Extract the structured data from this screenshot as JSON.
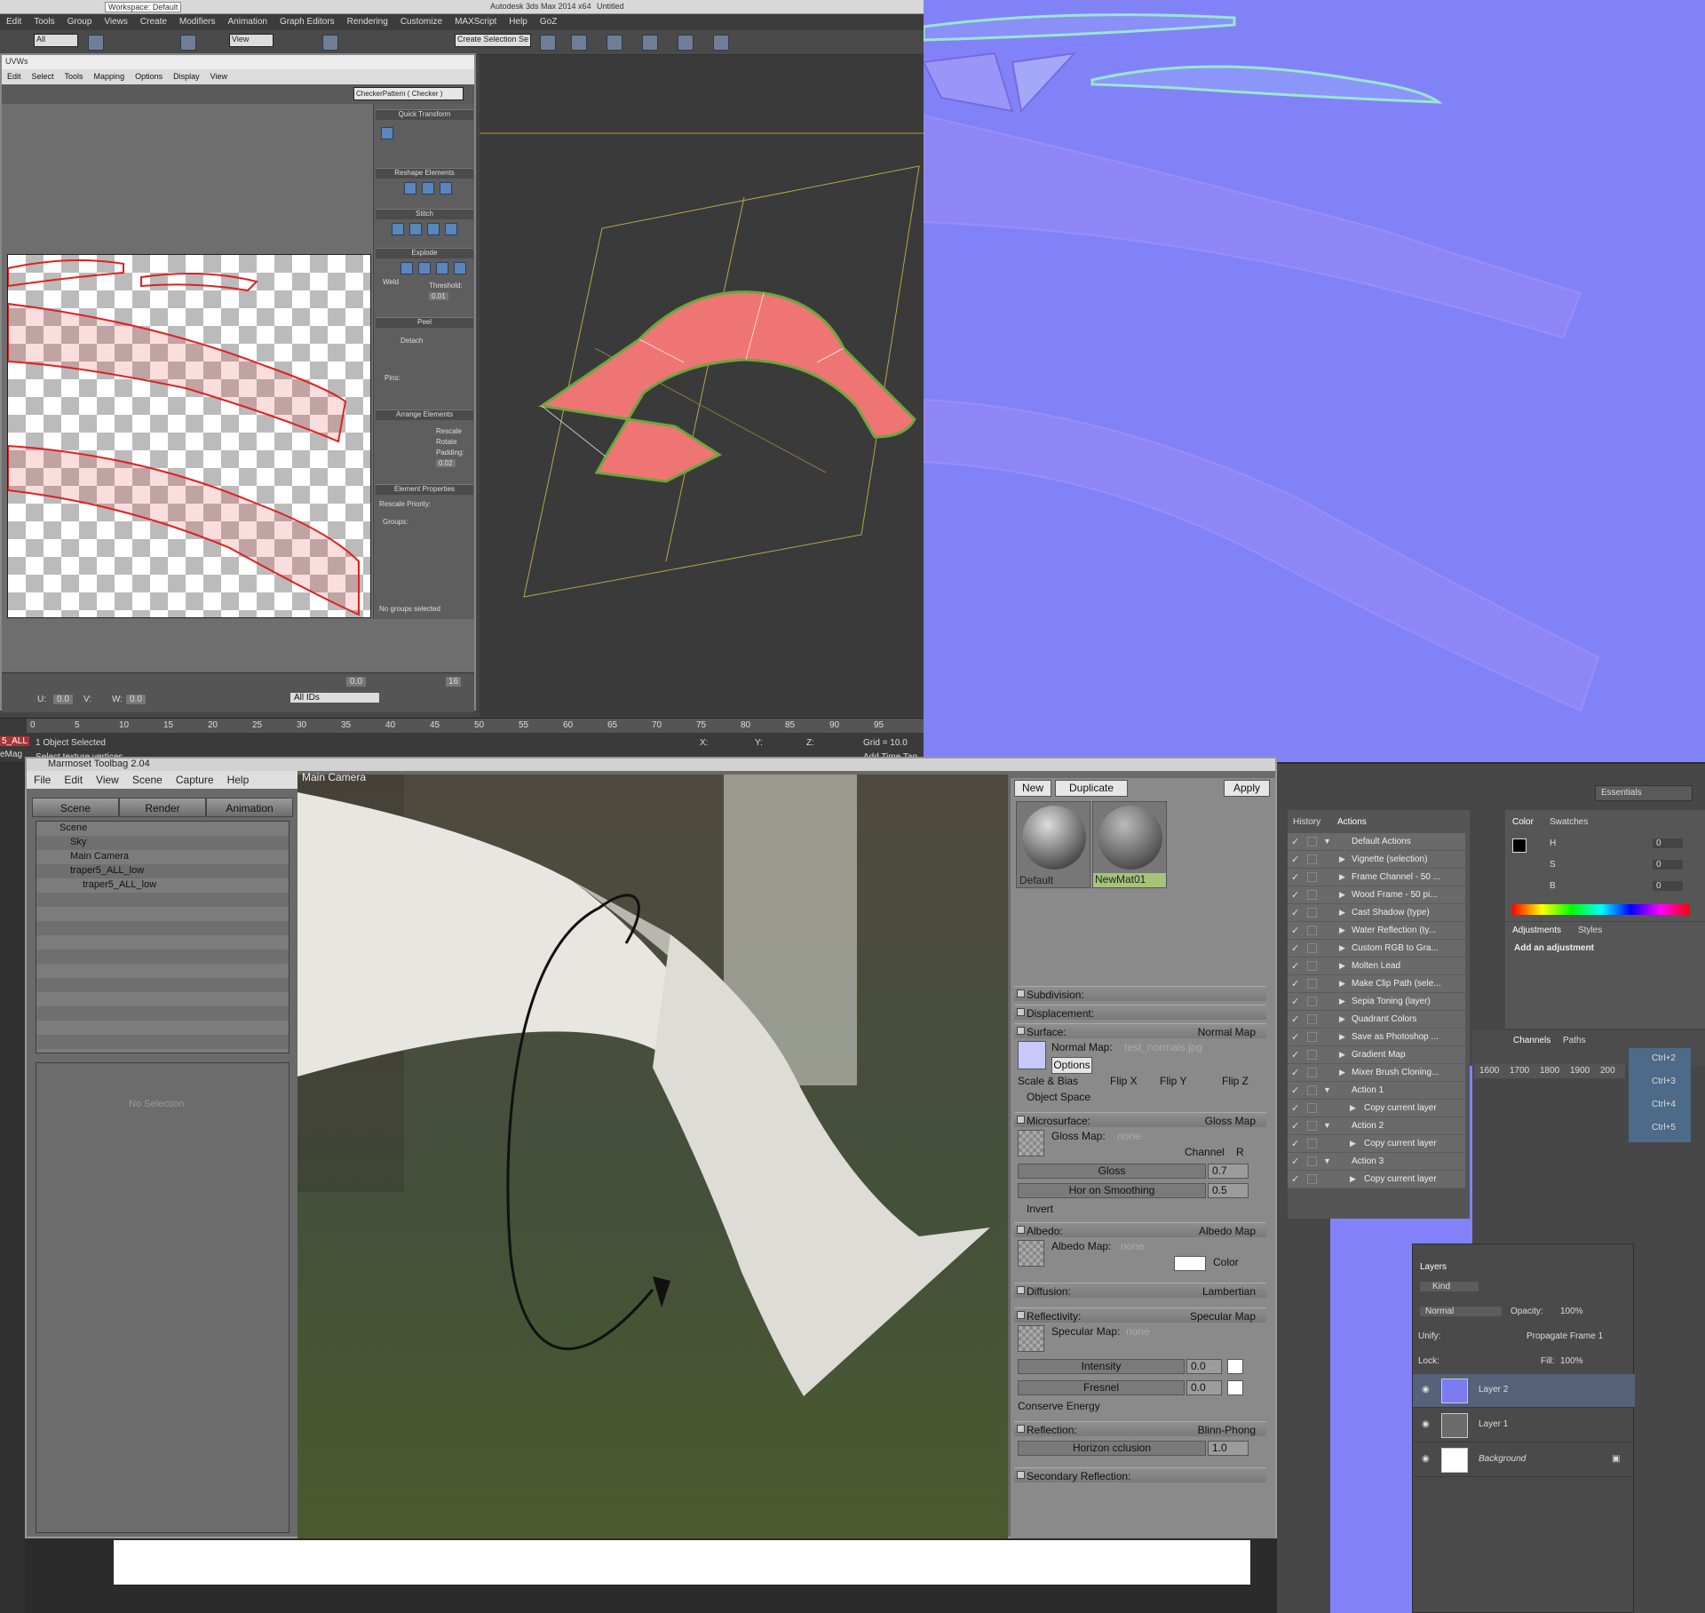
{
  "max": {
    "workspace": "Workspace: Default",
    "title": "Autodesk 3ds Max 2014 x64",
    "doc": "Untitled",
    "menu": [
      "Edit",
      "Tools",
      "Group",
      "Views",
      "Create",
      "Modifiers",
      "Animation",
      "Graph Editors",
      "Rendering",
      "Customize",
      "MAXScript",
      "Help",
      "GoZ"
    ],
    "selection_filter": "All",
    "view_dropdown": "View",
    "named_sel": "Create Selection Se",
    "uvw": {
      "title": "UVWs",
      "menu": [
        "Edit",
        "Select",
        "Tools",
        "Mapping",
        "Options",
        "Display",
        "View"
      ],
      "checker": "CheckerPattern  ( Checker )",
      "sections": [
        "Quick Transform",
        "Reshape Elements",
        "Stitch",
        "Explode",
        "Peel",
        "Arrange Elements",
        "Element Properties"
      ],
      "weld": "Weld",
      "threshold": "Threshold:",
      "threshold_val": "0.01",
      "detach": "Detach",
      "pins": "Pins:",
      "rescale": "Rescale",
      "rotate": "Rotate",
      "padding": "Padding:",
      "padding_val": "0.02",
      "rescale_priority": "Rescale Priority:",
      "groups": "Groups:",
      "no_groups": "No groups selected",
      "bottom_val": "0.0",
      "u_val": "0.0",
      "w_val": "0.0",
      "ids": "All IDs",
      "sixteen": "16",
      "u_label": "U:",
      "v_label": "V:",
      "w_label": "W:"
    },
    "timeline_ticks": [
      "0",
      "5",
      "10",
      "15",
      "20",
      "25",
      "30",
      "35",
      "40",
      "45",
      "50",
      "55",
      "60",
      "65",
      "70",
      "75",
      "80",
      "85",
      "90",
      "95"
    ],
    "status1": "1 Object Selected",
    "status2": "Select texture vertices",
    "grid": "Grid = 10.0",
    "add_time_tag": "Add Time Tag",
    "xyz": [
      "X:",
      "Y:",
      "Z:"
    ],
    "side_label": "5_ALL",
    "side_label2": "eMag"
  },
  "marmoset": {
    "title": "Marmoset Toolbag 2.04",
    "menu": [
      "File",
      "Edit",
      "View",
      "Scene",
      "Capture",
      "Help"
    ],
    "tabs": [
      "Scene",
      "Render",
      "Animation"
    ],
    "tree": [
      "Scene",
      "Sky",
      "Main Camera",
      "traper5_ALL_low",
      "traper5_ALL_low"
    ],
    "no_selection": "No Selection",
    "camera": "Main Camera",
    "new": "New",
    "duplicate": "Duplicate",
    "apply": "Apply",
    "materials": [
      "Default",
      "NewMat01"
    ],
    "subdivision": "Subdivision:",
    "displacement": "Displacement:",
    "surface": "Surface:",
    "surface_type": "Normal Map",
    "normal_map_label": "Normal Map:",
    "normal_map_file": "test_normals.jpg",
    "options": "Options",
    "scale_bias": "Scale & Bias",
    "flip_x": "Flip X",
    "flip_y": "Flip Y",
    "flip_z": "Flip Z",
    "object_space": "Object Space",
    "microsurface": "Microsurface:",
    "micro_type": "Gloss Map",
    "gloss_map_label": "Gloss Map:",
    "none": "none",
    "channel": "Channel",
    "channel_val": "R",
    "gloss": "Gloss",
    "gloss_val": "0.7",
    "horizon_smoothing": "Hor  on Smoothing",
    "horizon_smoothing_val": "0.5",
    "invert": "Invert",
    "albedo": "Albedo:",
    "albedo_type": "Albedo Map",
    "albedo_map_label": "Albedo Map:",
    "color": "Color",
    "diffusion": "Diffusion:",
    "diffusion_type": "Lambertian",
    "reflectivity": "Reflectivity:",
    "reflectivity_type": "Specular Map",
    "specular_map_label": "Specular Map:",
    "intensity": "Intensity",
    "intensity_val": "0.0",
    "fresnel": "Fresnel",
    "fresnel_val": "0.0",
    "conserve_energy": "Conserve Energy",
    "reflection": "Reflection:",
    "reflection_type": "Blinn-Phong",
    "horizon_occlusion": "Horizon  cclusion",
    "horizon_occlusion_val": "1.0",
    "secondary_reflection": "Secondary Reflection:"
  },
  "photoshop": {
    "essentials": "Essentials",
    "history_tab": "History",
    "actions_tab": "Actions",
    "actions": [
      "Default Actions",
      "Vignette (selection)",
      "Frame Channel - 50 ...",
      "Wood Frame - 50 pi...",
      "Cast Shadow (type)",
      "Water Reflection (ty...",
      "Custom RGB to Gra...",
      "Molten Lead",
      "Make Clip Path (sele...",
      "Sepia Toning (layer)",
      "Quadrant Colors",
      "Save as Photoshop ...",
      "Gradient Map",
      "Mixer Brush Cloning...",
      "Action 1",
      "Copy current layer",
      "Action 2",
      "Copy current layer",
      "Action 3",
      "Copy current layer"
    ],
    "color_tab": "Color",
    "swatches_tab": "Swatches",
    "hsb": [
      "H",
      "S",
      "B"
    ],
    "hsb_vals": [
      "0",
      "0",
      "0"
    ],
    "adjustments_tab": "Adjustments",
    "styles_tab": "Styles",
    "add_adjustment": "Add an adjustment",
    "channels_tab": "Channels",
    "paths_tab": "Paths",
    "ruler": [
      "1600",
      "1700",
      "1800",
      "1900",
      "200"
    ],
    "shortcuts": [
      "Ctrl+2",
      "Ctrl+3",
      "Ctrl+4",
      "Ctrl+5"
    ],
    "layers_tab": "Layers",
    "kind": "Kind",
    "blend": "Normal",
    "opacity_label": "Opacity:",
    "opacity": "100%",
    "unify": "Unify:",
    "propagate": "Propagate Frame 1",
    "lock": "Lock:",
    "fill_label": "Fill:",
    "fill": "100%",
    "layers": [
      "Layer 2",
      "Layer 1",
      "Background"
    ]
  },
  "colors": {
    "normal_map": "#8282f8",
    "uv_red": "#e02020",
    "mesh_red": "#f07070"
  }
}
